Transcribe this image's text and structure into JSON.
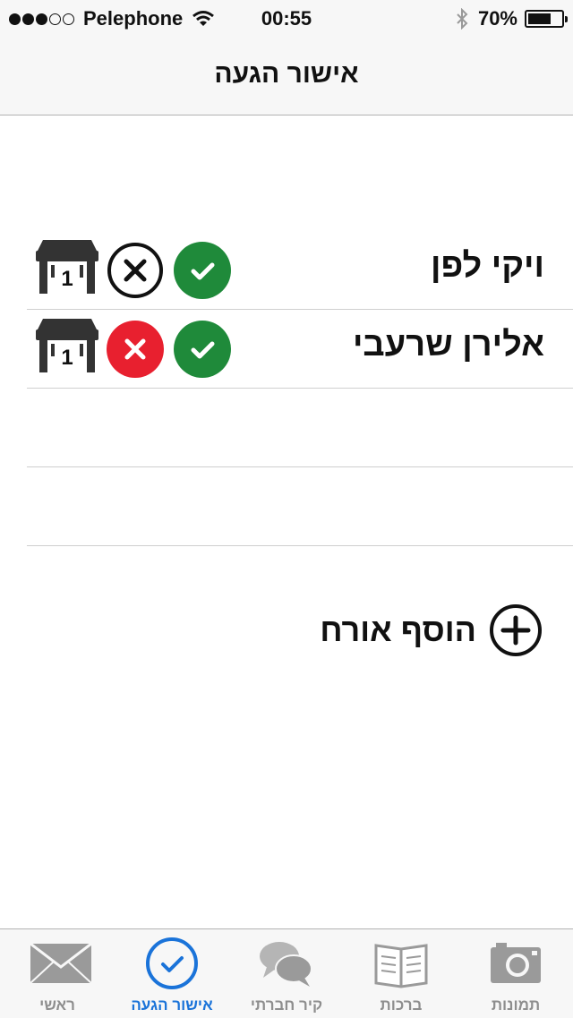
{
  "status_bar": {
    "carrier": "Pelephone",
    "time": "00:55",
    "battery_text": "70%",
    "battery_level": 0.7,
    "signal_full": 3,
    "signal_total": 5
  },
  "nav": {
    "title": "אישור הגעה"
  },
  "guests": [
    {
      "name": "ויקי לפן",
      "table_number": "1",
      "declined_state": "unselected",
      "confirmed_state": "selected"
    },
    {
      "name": "אלירן שרעבי",
      "table_number": "1",
      "declined_state": "selected",
      "confirmed_state": "selected"
    }
  ],
  "add_guest": {
    "label": "הוסף אורח"
  },
  "tabs": [
    {
      "label": "תמונות",
      "icon": "camera-icon",
      "active": false
    },
    {
      "label": "ברכות",
      "icon": "book-icon",
      "active": false
    },
    {
      "label": "קיר חברתי",
      "icon": "chat-bubbles-icon",
      "active": false
    },
    {
      "label": "אישור הגעה",
      "icon": "check-circle-icon",
      "active": true
    },
    {
      "label": "ראשי",
      "icon": "envelope-icon",
      "active": false
    }
  ],
  "colors": {
    "confirm_green": "#1f8a3a",
    "decline_red": "#e8202f",
    "active_tab_blue": "#1a73d9",
    "inactive_gray": "#8e8e8e"
  }
}
